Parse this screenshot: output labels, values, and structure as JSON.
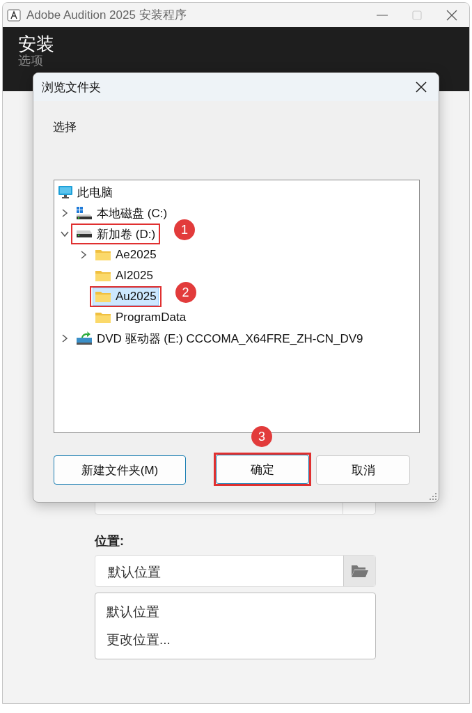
{
  "window": {
    "title": "Adobe Audition 2025 安装程序"
  },
  "header": {
    "title": "安装",
    "subtitle": "选项"
  },
  "location": {
    "label": "位置:",
    "value": "默认位置",
    "options": [
      "默认位置",
      "更改位置..."
    ]
  },
  "dialog": {
    "title": "浏览文件夹",
    "prompt": "选择",
    "tree": [
      {
        "label": "此电脑",
        "kind": "computer",
        "selected": false,
        "children": [
          {
            "label": "本地磁盘 (C:)",
            "kind": "system-drive",
            "selected": false,
            "expanded": false
          },
          {
            "label": "新加卷 (D:)",
            "kind": "drive",
            "selected": false,
            "expanded": true,
            "marker": "1",
            "children": [
              {
                "label": "Ae2025",
                "kind": "folder",
                "selected": false,
                "expanded": false
              },
              {
                "label": "AI2025",
                "kind": "folder",
                "selected": false
              },
              {
                "label": "Au2025",
                "kind": "folder",
                "selected": true,
                "marker": "2"
              },
              {
                "label": "ProgramData",
                "kind": "folder",
                "selected": false
              }
            ]
          },
          {
            "label": "DVD 驱动器 (E:) CCCOMA_X64FRE_ZH-CN_DV9",
            "kind": "dvd",
            "selected": false,
            "expanded": false
          }
        ]
      }
    ],
    "buttons": [
      {
        "label": "新建文件夹(M)",
        "default": true
      },
      {
        "label": "确定",
        "default": true,
        "marker": "3"
      },
      {
        "label": "取消",
        "default": false
      }
    ]
  }
}
